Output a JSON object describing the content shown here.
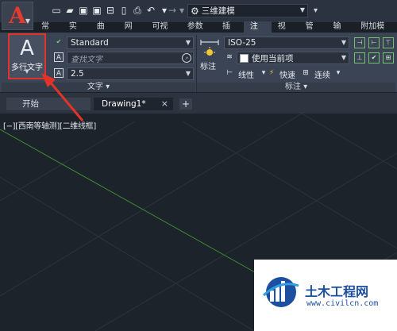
{
  "quick_access": {
    "workspace": "三维建模"
  },
  "ribbon": {
    "tabs": [
      "常用",
      "实体",
      "曲面",
      "网格",
      "可视化",
      "参数化",
      "插入",
      "注释",
      "视图",
      "管理",
      "输出",
      "附加模块"
    ],
    "active_tab": "注释",
    "text_panel": {
      "mtext_label": "多行文字",
      "text_style": "Standard",
      "find_placeholder": "查找文字",
      "text_height": "2.5",
      "panel_title": "文字 ▾"
    },
    "dim_panel": {
      "dim_label": "标注",
      "dim_style": "ISO-25",
      "layer_option": "使用当前项",
      "linear_label": "线性",
      "quick_label": "快速",
      "continue_label": "连续",
      "panel_title": "标注 ▾"
    }
  },
  "doc_tabs": {
    "start": "开始",
    "drawing": "Drawing1*",
    "close_glyph": "×",
    "new_glyph": "+"
  },
  "viewport": {
    "label": "[−][西南等轴测][二维线框]"
  },
  "watermark": {
    "title": "土木工程网",
    "url": "www.civilcn.com"
  },
  "colors": {
    "highlight_box": "#e0342a",
    "arrow": "#e0342a",
    "axis_line": "#3f8a32",
    "grid_line": "#2c333d"
  }
}
